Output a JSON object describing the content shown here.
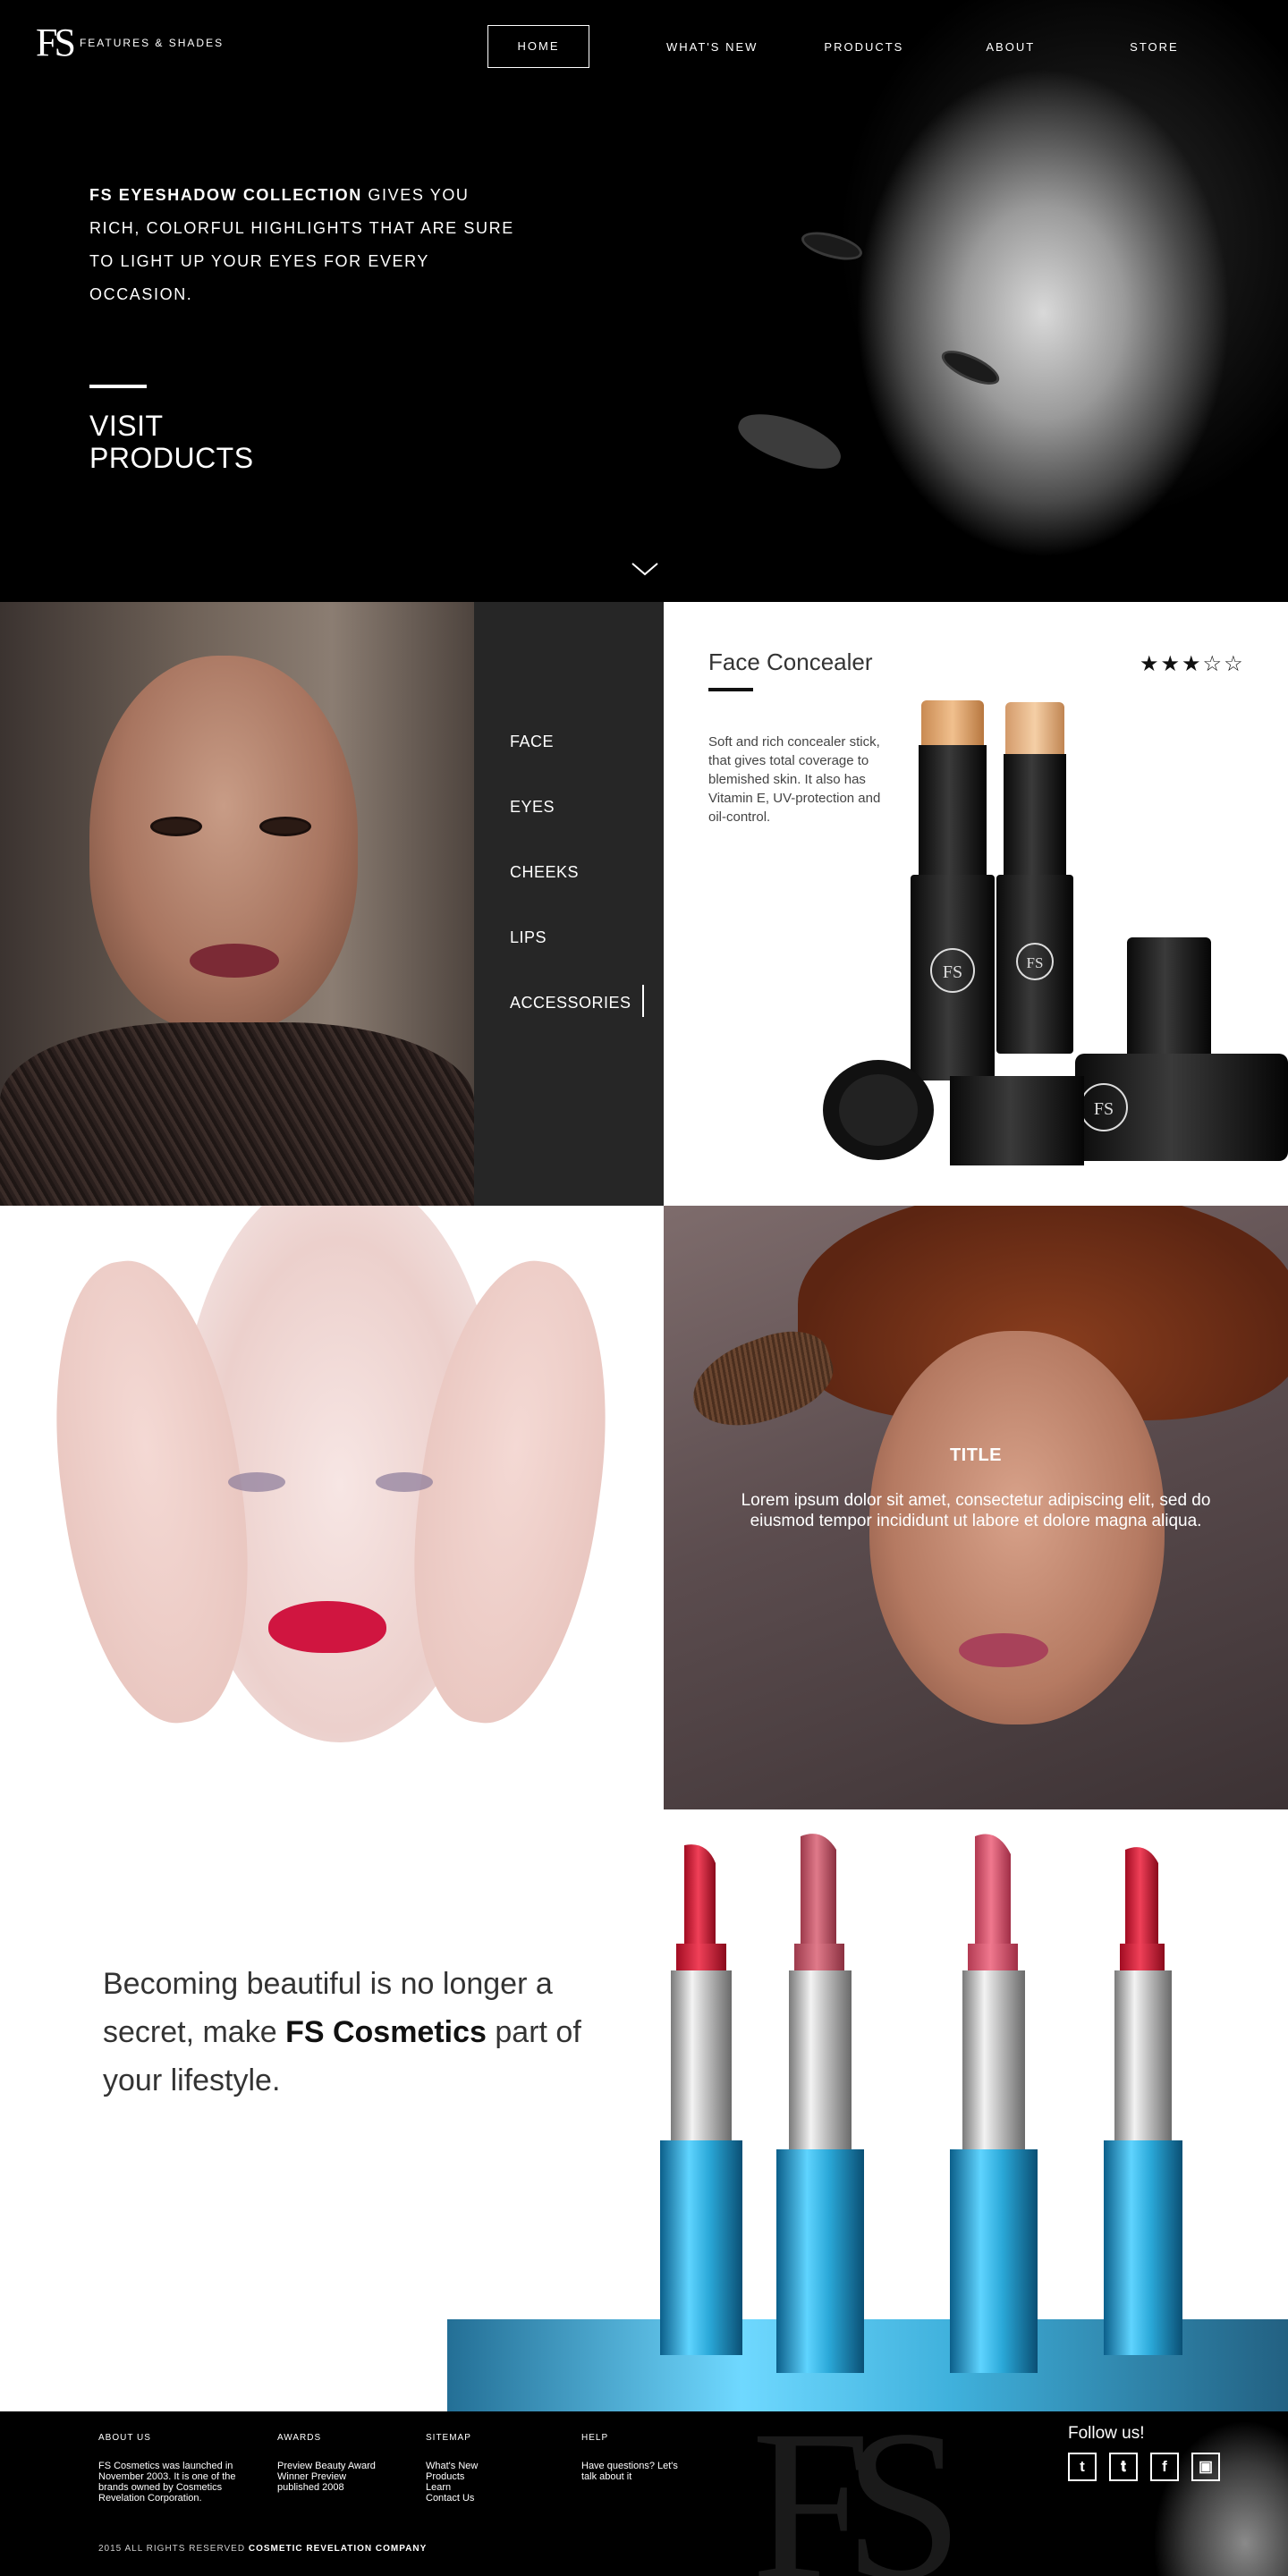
{
  "brand": {
    "mark": "FS",
    "name": "FEATURES & SHADES"
  },
  "nav": {
    "home": "HOME",
    "whats_new": "WHAT'S NEW",
    "products": "PRODUCTS",
    "about": "ABOUT",
    "store": "STORE",
    "active": "HOME"
  },
  "hero": {
    "headline_bold": "FS EYESHADOW COLLECTION",
    "headline_rest": " GIVES YOU RICH, COLORFUL HIGHLIGHTS THAT ARE SURE TO LIGHT UP YOUR EYES FOR EVERY OCCASION.",
    "cta": "VISIT PRODUCTS"
  },
  "categories": {
    "items": [
      "FACE",
      "EYES",
      "CHEEKS",
      "LIPS",
      "ACCESSORIES"
    ],
    "active": "ACCESSORIES"
  },
  "product": {
    "title": "Face Concealer",
    "rating": 3,
    "rating_max": 5,
    "description": "Soft and rich concealer stick, that gives total coverage to blemished skin. It also has Vitamin E, UV-protection and oil-control."
  },
  "feature": {
    "title": "TITLE",
    "text": "Lorem ipsum dolor sit amet, consectetur adipiscing elit, sed do eiusmod tempor incididunt ut labore et dolore magna aliqua."
  },
  "tagline": {
    "part1": "Becoming beautiful is no longer a secret, make ",
    "bold": "FS Cosmetics",
    "part2": " part of your lifestyle."
  },
  "footer": {
    "about_title": "ABOUT US",
    "about_text": "FS Cosmetics was launched in November 2003. It is one of the brands owned by Cosmetics Revelation Corporation.",
    "awards_title": "AWARDS",
    "awards_text": "Preview Beauty Award Winner Preview published 2008",
    "sitemap_title": "SITEMAP",
    "sitemap_items": [
      "What's New",
      "Products",
      "Learn",
      "Contact Us"
    ],
    "help_title": "HELP",
    "help_text": "Have questions? Let's talk about it",
    "follow": "Follow us!",
    "social": [
      "twitter",
      "twitter",
      "facebook",
      "instagram"
    ],
    "copyright": "2015 ALL RIGHTS RESERVED ",
    "company": "COSMETIC REVELATION COMPANY"
  },
  "colors": {
    "background": "#000000",
    "category_panel": "#262626",
    "lip_red": "#d01540",
    "lipstick_tube": "#2aa8d8"
  }
}
